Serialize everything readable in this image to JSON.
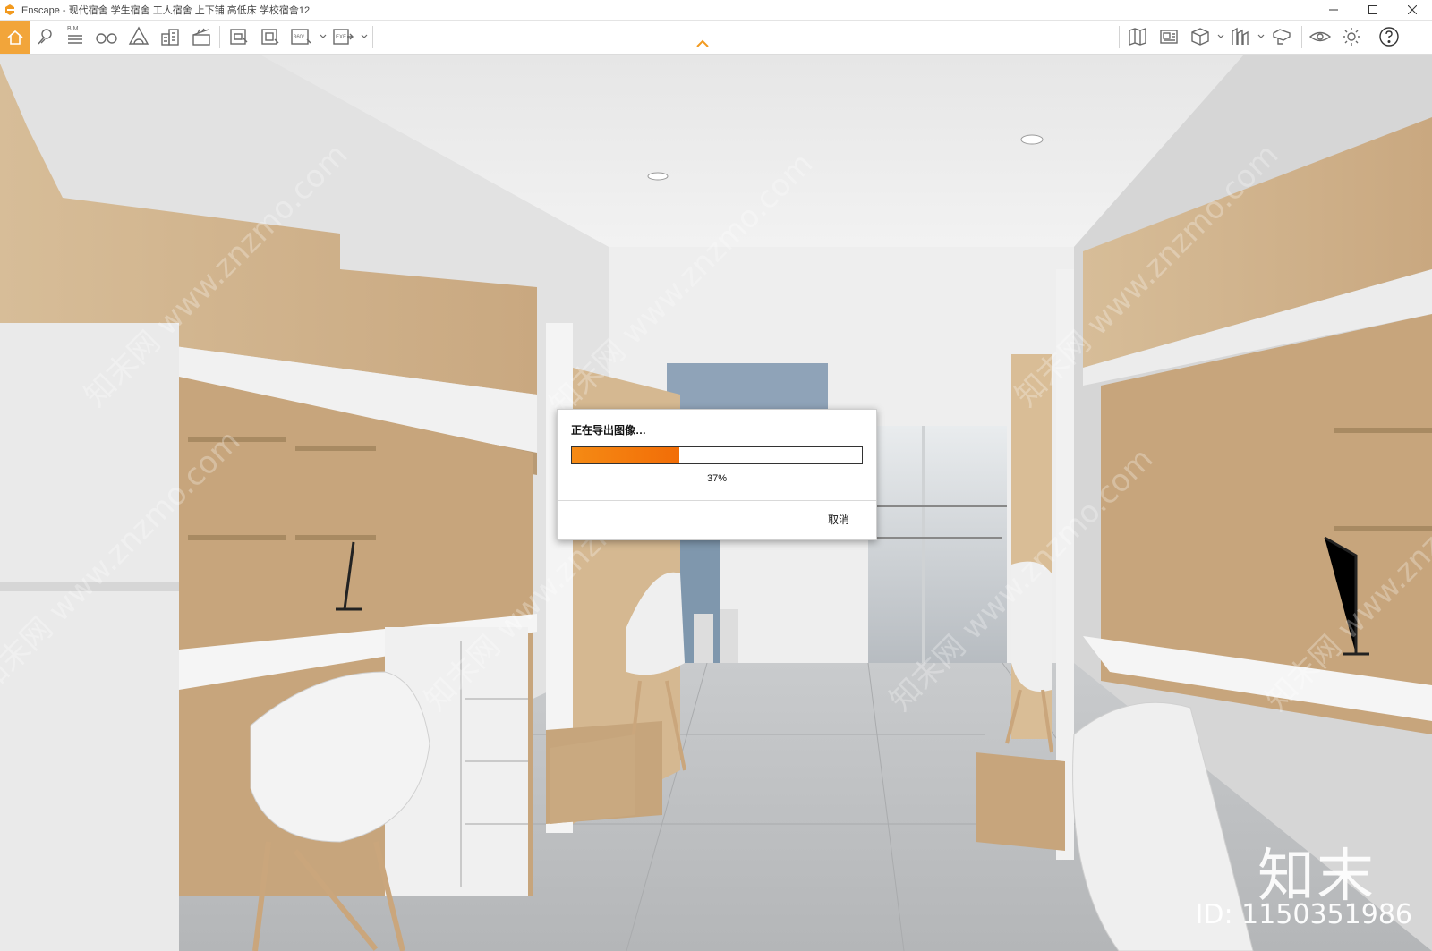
{
  "window": {
    "title": "Enscape - 现代宿舍 学生宿舍 工人宿舍 上下铺 高低床 学校宿舍12",
    "controls": [
      "minimize",
      "maximize",
      "close"
    ]
  },
  "toolbar": {
    "accent": "#f2a53a",
    "left_icons": [
      "home-icon",
      "location-pin-icon",
      "bim-list-icon",
      "binoculars-icon",
      "atmosphere-icon",
      "building-icon",
      "clapperboard-icon",
      "screenshot-icon",
      "batch-render-icon",
      "panorama-360-icon",
      "export-exe-icon"
    ],
    "bim_label": "BIM",
    "panorama_label": "360°",
    "exe_label": "EXE",
    "right_icons": [
      "map-icon",
      "views-icon",
      "cube-icon",
      "asset-library-icon",
      "materials-icon",
      "visual-settings-icon",
      "settings-gear-icon",
      "help-icon"
    ]
  },
  "dialog": {
    "title": "正在导出图像…",
    "progress": 0.37,
    "progress_text": "37%",
    "cancel_label": "取消",
    "progress_color": "#f47c0c"
  },
  "watermark": {
    "brand": "知末",
    "id_text": "ID: 1150351986",
    "diag_text": "知末网 www.znzmo.com"
  }
}
